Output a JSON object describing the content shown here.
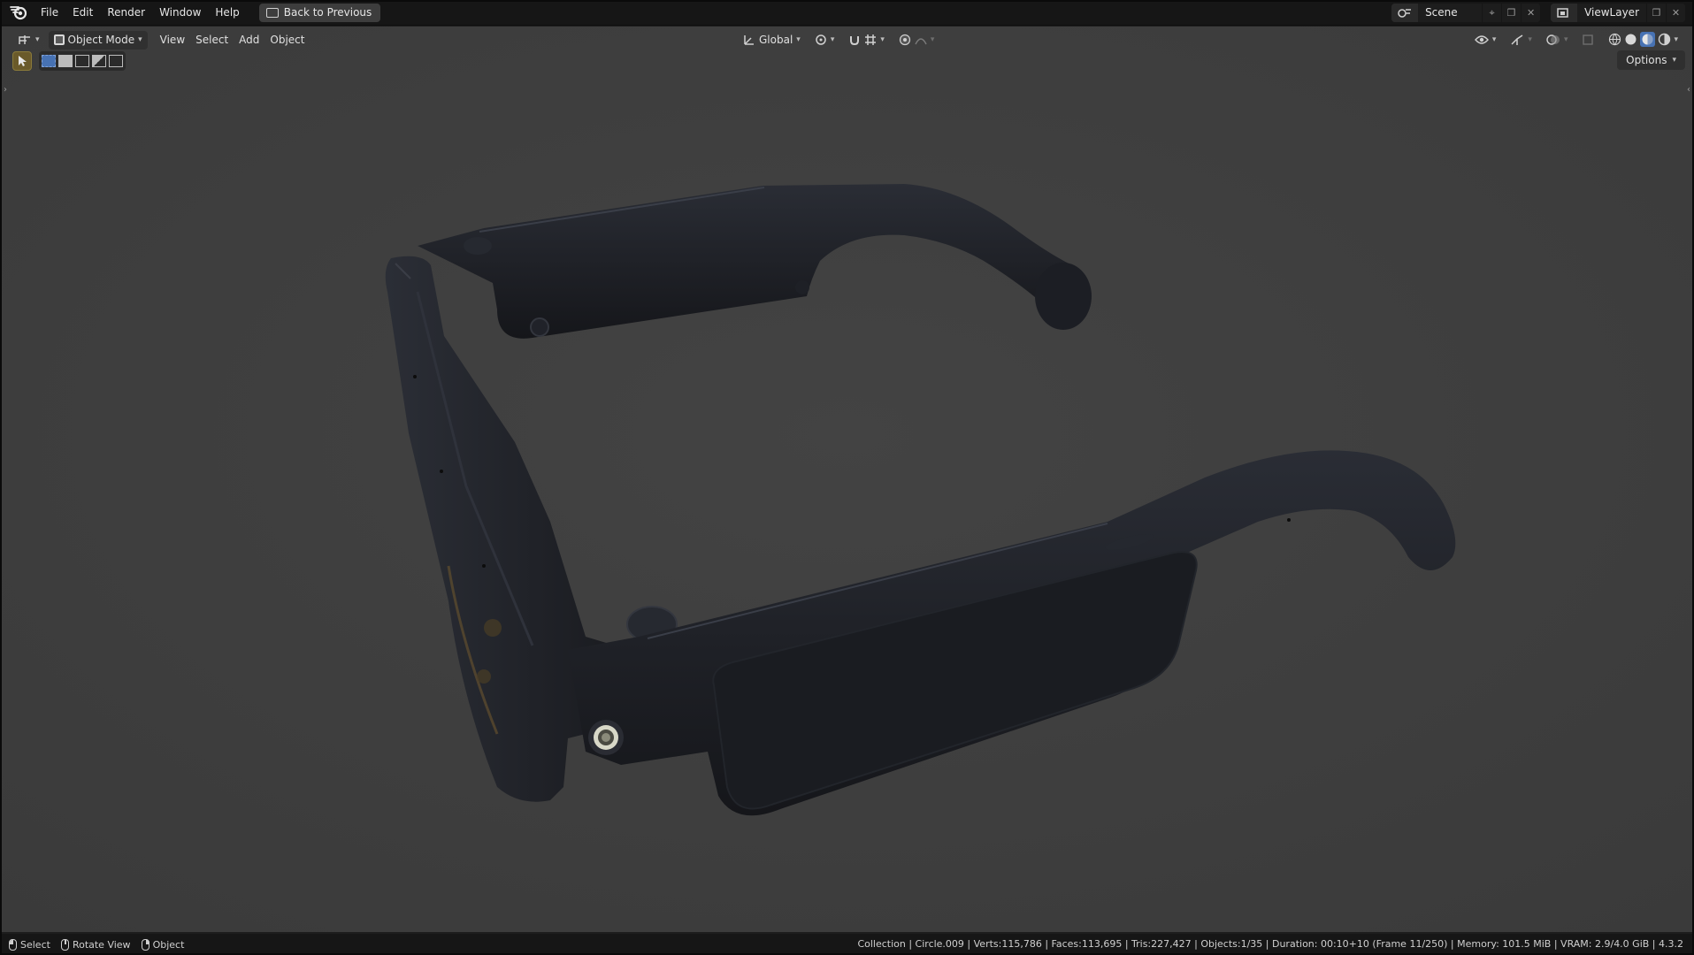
{
  "menubar": {
    "items": [
      "File",
      "Edit",
      "Render",
      "Window",
      "Help"
    ],
    "back_button": "Back to Previous",
    "scene": "Scene",
    "view_layer": "ViewLayer"
  },
  "viewport_header": {
    "mode": "Object Mode",
    "menus": [
      "View",
      "Select",
      "Add",
      "Object"
    ],
    "transform_orientation": "Global",
    "options": "Options"
  },
  "statusbar": {
    "hints": [
      "Select",
      "Rotate View",
      "Object"
    ],
    "stats": "Collection | Circle.009 | Verts:115,786 | Faces:113,695 | Tris:227,427 | Objects:1/35 | Duration: 00:10+10 (Frame 11/250) | Memory: 101.5 MiB | VRAM: 2.9/4.0 GiB | 4.3.2"
  },
  "colors": {
    "viewport_bg": "#3f3f3f",
    "object": "#1b1d23",
    "accent": "#4772b3"
  },
  "icons": {
    "logo": "blender-logo-icon",
    "back": "back-to-previous-icon",
    "scene": "scene-icon",
    "view_layer": "view-layer-icon",
    "editor": "editor-type-icon",
    "cursor": "select-tool-icon",
    "options": "chevron-down-icon"
  }
}
